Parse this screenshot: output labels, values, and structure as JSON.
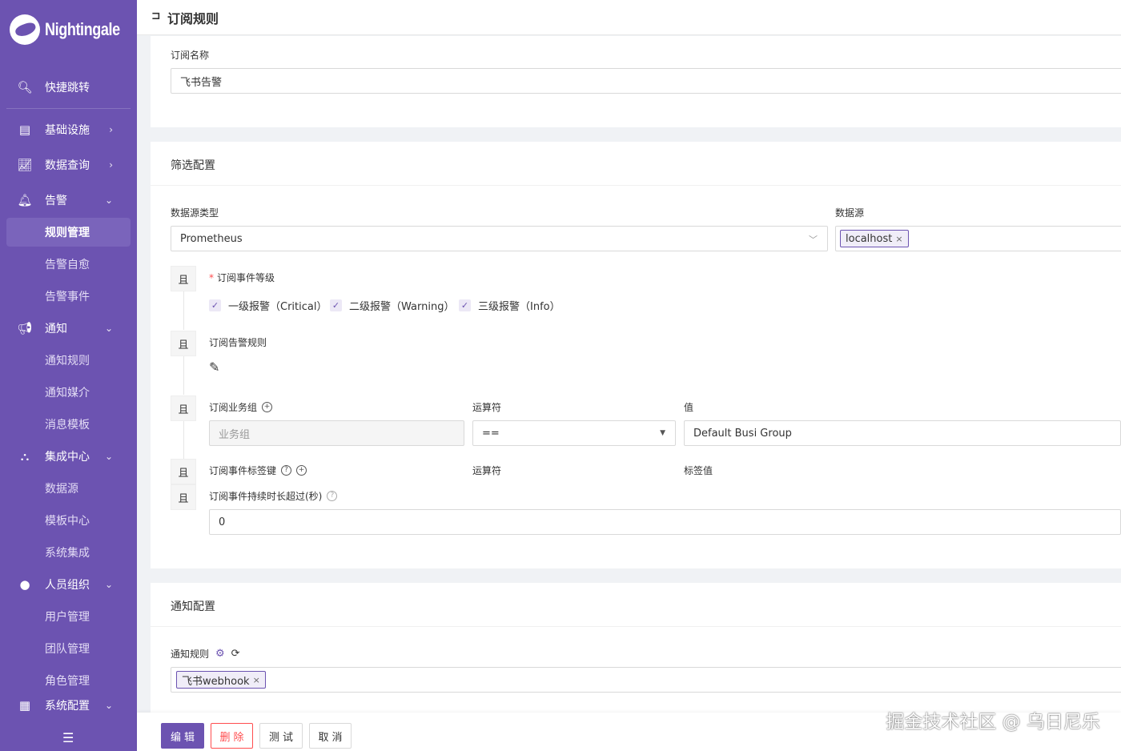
{
  "app": {
    "logo_text": "Nightingale"
  },
  "sidebar": {
    "quick_jump": "快捷跳转",
    "infra": "基础设施",
    "data_query": "数据查询",
    "alert": "告警",
    "alert_items": [
      "规则管理",
      "告警自愈",
      "告警事件"
    ],
    "notify": "通知",
    "notify_items": [
      "通知规则",
      "通知媒介",
      "消息模板"
    ],
    "integration": "集成中心",
    "integration_items": [
      "数据源",
      "模板中心",
      "系统集成"
    ],
    "org": "人员组织",
    "org_items": [
      "用户管理",
      "团队管理",
      "角色管理"
    ],
    "system": "系统配置"
  },
  "header": {
    "title": "订阅规则"
  },
  "basic": {
    "name_label": "订阅名称",
    "name_value": "飞书告警"
  },
  "filter": {
    "title": "筛选配置",
    "ds_type_label": "数据源类型",
    "ds_type_value": "Prometheus",
    "ds_label": "数据源",
    "ds_tag": "localhost",
    "and_label": "且",
    "severity_label": "订阅事件等级",
    "severities": [
      "一级报警（Critical）",
      "二级报警（Warning）",
      "三级报警（Info）"
    ],
    "alert_rule_label": "订阅告警规则",
    "busi_group_label": "订阅业务组",
    "operator_label": "运算符",
    "value_label": "值",
    "busi_group_placeholder": "业务组",
    "operator_value": "==",
    "busi_group_value": "Default Busi Group",
    "tag_key_label": "订阅事件标签键",
    "tag_value_label": "标签值",
    "duration_label": "订阅事件持续时长超过(秒)",
    "duration_value": "0"
  },
  "notify_cfg": {
    "title": "通知配置",
    "rule_label": "通知规则",
    "rule_tag": "飞书webhook"
  },
  "footer": {
    "edit": "编辑",
    "delete": "删除",
    "test": "测试",
    "cancel": "取消"
  },
  "watermark": "掘金技术社区 @ 乌日尼乐",
  "colors": {
    "primary": "#6c53b1",
    "danger": "#ff4d4f"
  }
}
